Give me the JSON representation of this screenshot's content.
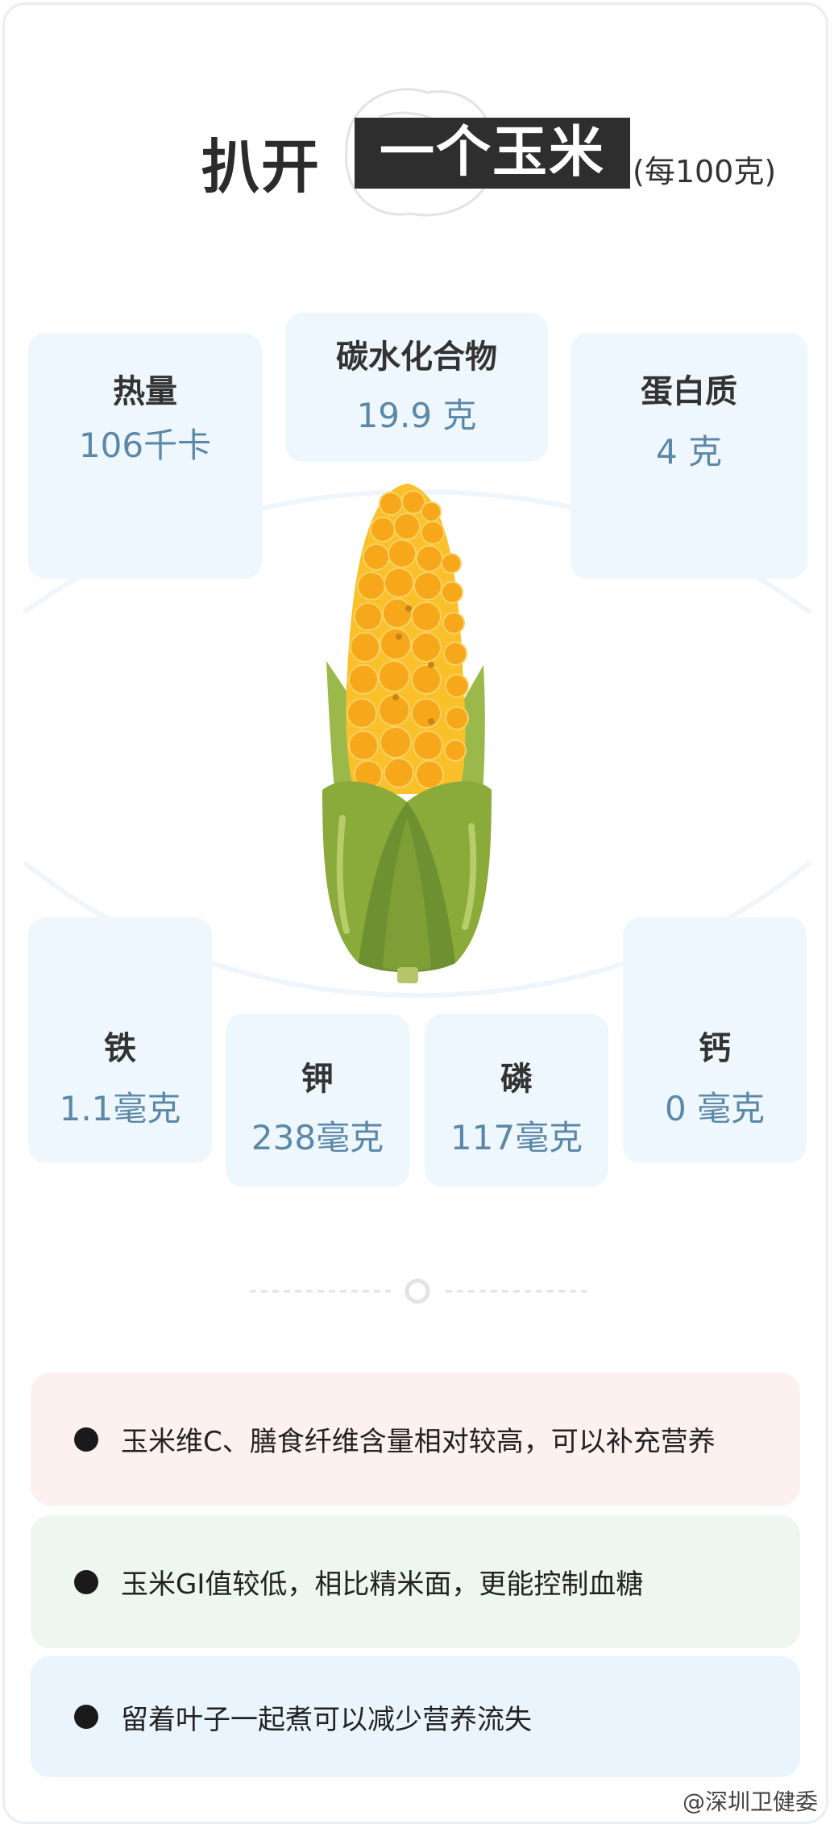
{
  "title": {
    "prefix": "扒开",
    "highlight": "一个玉米",
    "suffix": "(每100克)"
  },
  "macros": [
    {
      "label": "热量",
      "value": "106千卡"
    },
    {
      "label": "碳水化合物",
      "value": "19.9 克"
    },
    {
      "label": "蛋白质",
      "value": "4 克"
    }
  ],
  "minerals": [
    {
      "label": "铁",
      "value": "1.1毫克"
    },
    {
      "label": "钾",
      "value": "238毫克"
    },
    {
      "label": "磷",
      "value": "117毫克"
    },
    {
      "label": "钙",
      "value": "0 毫克"
    }
  ],
  "tips": [
    {
      "text": "玉米维C、膳食纤维含量相对较高，可以补充营养",
      "bg": "#fdf1ef"
    },
    {
      "text": "玉米GI值较低，相比精米面，更能控制血糖",
      "bg": "#eef7ef"
    },
    {
      "text": "留着叶子一起煮可以减少营养流失",
      "bg": "#e9f4fc"
    }
  ],
  "watermark": "@深圳卫健委",
  "colors": {
    "card_bg": "#eef7fd",
    "value_text": "#5b87a8",
    "title_box": "#2e2e2e",
    "kernel": "#f7b21c",
    "husk": "#8aaa3a"
  }
}
